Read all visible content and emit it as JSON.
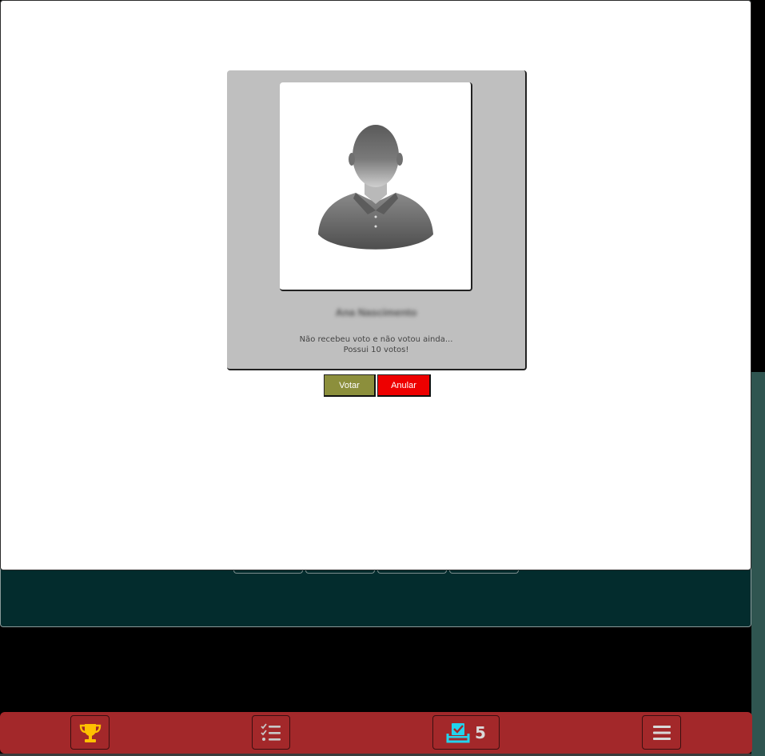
{
  "modal": {
    "candidate": {
      "name": "Ana Nascimento",
      "status_line1": "Não recebeu voto e não votou ainda...",
      "status_line2": "Possui 10 votos!",
      "avatar_icon": "user-silhouette-icon"
    },
    "actions": {
      "vote_label": "Votar",
      "void_label": "Anular"
    }
  },
  "bottom_nav": {
    "items": [
      {
        "icon": "trophy-icon",
        "color": "#ffc000"
      },
      {
        "icon": "checklist-icon",
        "color": "#c8c8c8"
      },
      {
        "icon": "ballot-box-check-icon",
        "color": "#22d3ee",
        "count": "5"
      },
      {
        "icon": "hamburger-menu-icon",
        "color": "#d9d9d9"
      }
    ]
  },
  "colors": {
    "nav_bg": "#a3282a",
    "vote_button": "#8c8f3c",
    "void_button": "#ee0000",
    "card_bg": "#bfbfbf",
    "background_panel": "#032c2d"
  }
}
